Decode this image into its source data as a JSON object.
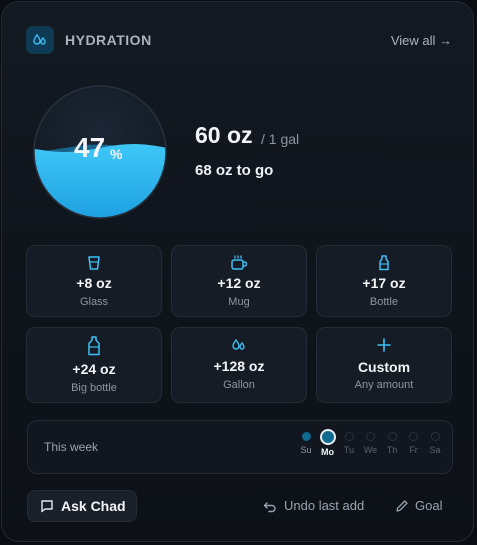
{
  "header": {
    "title": "HYDRATION",
    "view_all": "View all →",
    "icon": "droplets-icon"
  },
  "gauge": {
    "value": "47",
    "unit": "%",
    "fill_fraction": 0.47
  },
  "summary": {
    "total": "60 oz",
    "goal": "/ 1 gal",
    "remaining": "68 oz to go"
  },
  "tiles": [
    {
      "amount": "+8 oz",
      "label": "Glass",
      "icon": "glass-icon"
    },
    {
      "amount": "+12 oz",
      "label": "Mug",
      "icon": "mug-icon"
    },
    {
      "amount": "+17 oz",
      "label": "Bottle",
      "icon": "bottle-icon"
    },
    {
      "amount": "+24 oz",
      "label": "Big bottle",
      "icon": "big-bottle-icon"
    },
    {
      "amount": "+128 oz",
      "label": "Gallon",
      "icon": "droplets-icon"
    },
    {
      "amount": "Custom",
      "label": "Any amount",
      "icon": "plus-icon"
    }
  ],
  "week": {
    "label": "This week",
    "days": [
      {
        "label": "Su",
        "state": "done"
      },
      {
        "label": "Mo",
        "state": "today"
      },
      {
        "label": "Tu",
        "state": "future"
      },
      {
        "label": "We",
        "state": "future"
      },
      {
        "label": "Th",
        "state": "future"
      },
      {
        "label": "Fr",
        "state": "future"
      },
      {
        "label": "Sa",
        "state": "future"
      }
    ]
  },
  "footer": {
    "ask": "Ask Chad",
    "undo": "Undo last add",
    "goal": "Goal"
  },
  "colors": {
    "accent": "#29b6f0",
    "water_top": "#3fc7f7",
    "water_bottom": "#1fa2e2"
  }
}
